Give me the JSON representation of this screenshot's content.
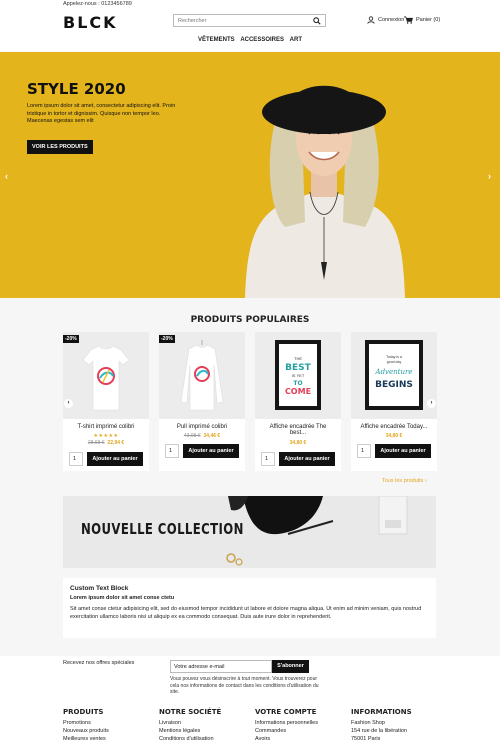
{
  "header": {
    "phone": "Appelez-nous : 0123456789",
    "logo": "BLCK",
    "search_placeholder": "Rechercher",
    "account_label": "Connexion",
    "cart_label": "Panier (0)",
    "nav": [
      "VÊTEMENTS",
      "ACCESSOIRES",
      "ART"
    ]
  },
  "hero": {
    "title": "STYLE 2020",
    "text": "Lorem ipsum dolor sit amet, consectetur adipiscing elit. Proin tristique in tortor et dignissim. Quisque non tempor leo. Maecenas egestas sem elit",
    "button": "VOIR LES PRODUITS",
    "prev": "‹",
    "next": "›",
    "background_color": "#e4b41d"
  },
  "products": {
    "title": "PRODUITS POPULAIRES",
    "items": [
      {
        "badge": "-20%",
        "name": "T-shirt imprimé colibri",
        "stars": "★★★★★",
        "old_price": "28,68 €",
        "price": "22,94 €",
        "qty": "1",
        "add": "Ajouter au panier"
      },
      {
        "badge": "-20%",
        "name": "Pull imprimé colibri",
        "stars": "",
        "old_price": "43,08 €",
        "price": "34,46 €",
        "qty": "1",
        "add": "Ajouter au panier"
      },
      {
        "badge": "",
        "name": "Affiche encadrée The best...",
        "stars": "",
        "old_price": "",
        "price": "34,80 €",
        "qty": "1",
        "add": "Ajouter au panier"
      },
      {
        "badge": "",
        "name": "Affiche encadrée Today...",
        "stars": "",
        "old_price": "",
        "price": "34,80 €",
        "qty": "1",
        "add": "Ajouter au panier"
      }
    ],
    "poster1": [
      "THE",
      "BEST",
      "IS YET",
      "TO",
      "COME"
    ],
    "poster2": [
      "Today is a",
      "good day",
      "Adventure",
      "BEGINS"
    ],
    "all_products": "Tous les produits  ›",
    "prev": "‹",
    "next": "›"
  },
  "banner": {
    "text": "NOUVELLE COLLECTION"
  },
  "custom_block": {
    "title": "Custom Text Block",
    "subtitle": "Lorem ipsum dolor sit amet conse ctetu",
    "body": "Sit amet conse ctetur adipisicing elit, sed do eiusmod tempor incididunt ut labore et dolore magna aliqua. Ut enim ad minim veniam, quis nostrud exercitation ullamco laboris nisi ut aliquip ex ea commodo consequat. Duis aute irure dolor in reprehenderit."
  },
  "newsletter": {
    "label": "Recevez nos offres spéciales",
    "placeholder": "Votre adresse e-mail",
    "button": "S'abonner",
    "note": "Vous pouvez vous désinscrire à tout moment. Vous trouverez pour cela nos informations de contact dans les conditions d'utilisation du site."
  },
  "footer": {
    "columns": [
      {
        "title": "PRODUITS",
        "links": [
          "Promotions",
          "Nouveaux produits",
          "Meilleures ventes"
        ]
      },
      {
        "title": "NOTRE SOCIÉTÉ",
        "links": [
          "Livraison",
          "Mentions légales",
          "Conditions d'utilisation"
        ]
      },
      {
        "title": "VOTRE COMPTE",
        "links": [
          "Informations personnelles",
          "Commandes",
          "Avoirs"
        ]
      },
      {
        "title": "INFORMATIONS",
        "links": [
          "Fashion Shop",
          "154 rue de la libération",
          "75001 Paris"
        ]
      }
    ]
  }
}
